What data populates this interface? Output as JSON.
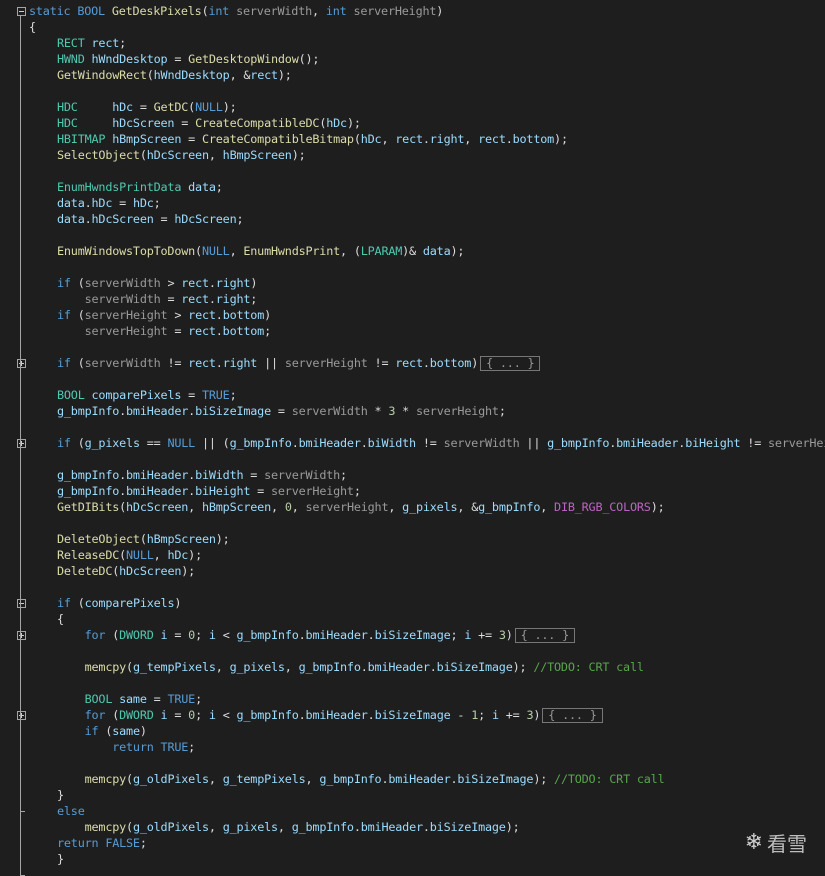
{
  "editor": {
    "lines": [
      [
        [
          "k",
          "static "
        ],
        [
          "k",
          "BOOL "
        ],
        [
          "f",
          "GetDeskPixels"
        ],
        [
          "s",
          "("
        ],
        [
          "k",
          "int "
        ],
        [
          "p",
          "serverWidth"
        ],
        [
          "s",
          ", "
        ],
        [
          "k",
          "int "
        ],
        [
          "p",
          "serverHeight"
        ],
        [
          "s",
          ")"
        ]
      ],
      [
        [
          "s",
          "{"
        ]
      ],
      [
        [
          "t",
          "RECT "
        ],
        [
          "v",
          "rect"
        ],
        [
          "s",
          ";"
        ]
      ],
      [
        [
          "t",
          "HWND "
        ],
        [
          "v",
          "hWndDesktop"
        ],
        [
          "s",
          " = "
        ],
        [
          "f",
          "GetDesktopWindow"
        ],
        [
          "s",
          "();"
        ]
      ],
      [
        [
          "f",
          "GetWindowRect"
        ],
        [
          "s",
          "("
        ],
        [
          "v",
          "hWndDesktop"
        ],
        [
          "s",
          ", &"
        ],
        [
          "v",
          "rect"
        ],
        [
          "s",
          ");"
        ]
      ],
      [],
      [
        [
          "t",
          "HDC     "
        ],
        [
          "v",
          "hDc"
        ],
        [
          "s",
          " = "
        ],
        [
          "f",
          "GetDC"
        ],
        [
          "s",
          "("
        ],
        [
          "k",
          "NULL"
        ],
        [
          "s",
          ");"
        ]
      ],
      [
        [
          "t",
          "HDC     "
        ],
        [
          "v",
          "hDcScreen"
        ],
        [
          "s",
          " = "
        ],
        [
          "f",
          "CreateCompatibleDC"
        ],
        [
          "s",
          "("
        ],
        [
          "v",
          "hDc"
        ],
        [
          "s",
          ");"
        ]
      ],
      [
        [
          "t",
          "HBITMAP "
        ],
        [
          "v",
          "hBmpScreen"
        ],
        [
          "s",
          " = "
        ],
        [
          "f",
          "CreateCompatibleBitmap"
        ],
        [
          "s",
          "("
        ],
        [
          "v",
          "hDc"
        ],
        [
          "s",
          ", "
        ],
        [
          "v",
          "rect"
        ],
        [
          "s",
          "."
        ],
        [
          "v",
          "right"
        ],
        [
          "s",
          ", "
        ],
        [
          "v",
          "rect"
        ],
        [
          "s",
          "."
        ],
        [
          "v",
          "bottom"
        ],
        [
          "s",
          ");"
        ]
      ],
      [
        [
          "f",
          "SelectObject"
        ],
        [
          "s",
          "("
        ],
        [
          "v",
          "hDcScreen"
        ],
        [
          "s",
          ", "
        ],
        [
          "v",
          "hBmpScreen"
        ],
        [
          "s",
          ");"
        ]
      ],
      [],
      [
        [
          "t",
          "EnumHwndsPrintData "
        ],
        [
          "v",
          "data"
        ],
        [
          "s",
          ";"
        ]
      ],
      [
        [
          "v",
          "data"
        ],
        [
          "s",
          "."
        ],
        [
          "v",
          "hDc"
        ],
        [
          "s",
          " = "
        ],
        [
          "v",
          "hDc"
        ],
        [
          "s",
          ";"
        ]
      ],
      [
        [
          "v",
          "data"
        ],
        [
          "s",
          "."
        ],
        [
          "v",
          "hDcScreen"
        ],
        [
          "s",
          " = "
        ],
        [
          "v",
          "hDcScreen"
        ],
        [
          "s",
          ";"
        ]
      ],
      [],
      [
        [
          "f",
          "EnumWindowsTopToDown"
        ],
        [
          "s",
          "("
        ],
        [
          "k",
          "NULL"
        ],
        [
          "s",
          ", "
        ],
        [
          "f",
          "EnumHwndsPrint"
        ],
        [
          "s",
          ", ("
        ],
        [
          "t",
          "LPARAM"
        ],
        [
          "s",
          ")& "
        ],
        [
          "v",
          "data"
        ],
        [
          "s",
          ");"
        ]
      ],
      [],
      [
        [
          "k",
          "if "
        ],
        [
          "s",
          "("
        ],
        [
          "p",
          "serverWidth"
        ],
        [
          "s",
          " > "
        ],
        [
          "v",
          "rect"
        ],
        [
          "s",
          "."
        ],
        [
          "v",
          "right"
        ],
        [
          "s",
          ")"
        ]
      ],
      [
        [
          "s",
          "    "
        ],
        [
          "p",
          "serverWidth"
        ],
        [
          "s",
          " = "
        ],
        [
          "v",
          "rect"
        ],
        [
          "s",
          "."
        ],
        [
          "v",
          "right"
        ],
        [
          "s",
          ";"
        ]
      ],
      [
        [
          "k",
          "if "
        ],
        [
          "s",
          "("
        ],
        [
          "p",
          "serverHeight"
        ],
        [
          "s",
          " > "
        ],
        [
          "v",
          "rect"
        ],
        [
          "s",
          "."
        ],
        [
          "v",
          "bottom"
        ],
        [
          "s",
          ")"
        ]
      ],
      [
        [
          "s",
          "    "
        ],
        [
          "p",
          "serverHeight"
        ],
        [
          "s",
          " = "
        ],
        [
          "v",
          "rect"
        ],
        [
          "s",
          "."
        ],
        [
          "v",
          "bottom"
        ],
        [
          "s",
          ";"
        ]
      ],
      [],
      [
        [
          "k",
          "if "
        ],
        [
          "s",
          "("
        ],
        [
          "p",
          "serverWidth"
        ],
        [
          "s",
          " != "
        ],
        [
          "v",
          "rect"
        ],
        [
          "s",
          "."
        ],
        [
          "v",
          "right"
        ],
        [
          "s",
          " || "
        ],
        [
          "p",
          "serverHeight"
        ],
        [
          "s",
          " != "
        ],
        [
          "v",
          "rect"
        ],
        [
          "s",
          "."
        ],
        [
          "v",
          "bottom"
        ],
        [
          "s",
          ")"
        ],
        [
          "box",
          "{ ... }"
        ]
      ],
      [],
      [
        [
          "t",
          "BOOL "
        ],
        [
          "v",
          "comparePixels"
        ],
        [
          "s",
          " = "
        ],
        [
          "k",
          "TRUE"
        ],
        [
          "s",
          ";"
        ]
      ],
      [
        [
          "v",
          "g_bmpInfo"
        ],
        [
          "s",
          "."
        ],
        [
          "v",
          "bmiHeader"
        ],
        [
          "s",
          "."
        ],
        [
          "v",
          "biSizeImage"
        ],
        [
          "s",
          " = "
        ],
        [
          "p",
          "serverWidth"
        ],
        [
          "s",
          " * "
        ],
        [
          "n",
          "3"
        ],
        [
          "s",
          " * "
        ],
        [
          "p",
          "serverHeight"
        ],
        [
          "s",
          ";"
        ]
      ],
      [],
      [
        [
          "k",
          "if "
        ],
        [
          "s",
          "("
        ],
        [
          "v",
          "g_pixels"
        ],
        [
          "s",
          " == "
        ],
        [
          "k",
          "NULL"
        ],
        [
          "s",
          " || ("
        ],
        [
          "v",
          "g_bmpInfo"
        ],
        [
          "s",
          "."
        ],
        [
          "v",
          "bmiHeader"
        ],
        [
          "s",
          "."
        ],
        [
          "v",
          "biWidth"
        ],
        [
          "s",
          " != "
        ],
        [
          "p",
          "serverWidth"
        ],
        [
          "s",
          " || "
        ],
        [
          "v",
          "g_bmpInfo"
        ],
        [
          "s",
          "."
        ],
        [
          "v",
          "bmiHeader"
        ],
        [
          "s",
          "."
        ],
        [
          "v",
          "biHeight"
        ],
        [
          "s",
          " != "
        ],
        [
          "p",
          "serverHeight"
        ]
      ],
      [],
      [
        [
          "v",
          "g_bmpInfo"
        ],
        [
          "s",
          "."
        ],
        [
          "v",
          "bmiHeader"
        ],
        [
          "s",
          "."
        ],
        [
          "v",
          "biWidth"
        ],
        [
          "s",
          " = "
        ],
        [
          "p",
          "serverWidth"
        ],
        [
          "s",
          ";"
        ]
      ],
      [
        [
          "v",
          "g_bmpInfo"
        ],
        [
          "s",
          "."
        ],
        [
          "v",
          "bmiHeader"
        ],
        [
          "s",
          "."
        ],
        [
          "v",
          "biHeight"
        ],
        [
          "s",
          " = "
        ],
        [
          "p",
          "serverHeight"
        ],
        [
          "s",
          ";"
        ]
      ],
      [
        [
          "f",
          "GetDIBits"
        ],
        [
          "s",
          "("
        ],
        [
          "v",
          "hDcScreen"
        ],
        [
          "s",
          ", "
        ],
        [
          "v",
          "hBmpScreen"
        ],
        [
          "s",
          ", "
        ],
        [
          "n",
          "0"
        ],
        [
          "s",
          ", "
        ],
        [
          "p",
          "serverHeight"
        ],
        [
          "s",
          ", "
        ],
        [
          "v",
          "g_pixels"
        ],
        [
          "s",
          ", &"
        ],
        [
          "v",
          "g_bmpInfo"
        ],
        [
          "s",
          ", "
        ],
        [
          "m",
          "DIB_RGB_COLORS"
        ],
        [
          "s",
          ");"
        ]
      ],
      [],
      [
        [
          "f",
          "DeleteObject"
        ],
        [
          "s",
          "("
        ],
        [
          "v",
          "hBmpScreen"
        ],
        [
          "s",
          ");"
        ]
      ],
      [
        [
          "f",
          "ReleaseDC"
        ],
        [
          "s",
          "("
        ],
        [
          "k",
          "NULL"
        ],
        [
          "s",
          ", "
        ],
        [
          "v",
          "hDc"
        ],
        [
          "s",
          ");"
        ]
      ],
      [
        [
          "f",
          "DeleteDC"
        ],
        [
          "s",
          "("
        ],
        [
          "v",
          "hDcScreen"
        ],
        [
          "s",
          ");"
        ]
      ],
      [],
      [
        [
          "k",
          "if "
        ],
        [
          "s",
          "("
        ],
        [
          "v",
          "comparePixels"
        ],
        [
          "s",
          ")"
        ]
      ],
      [
        [
          "s",
          "{"
        ]
      ],
      [
        [
          "s",
          "    "
        ],
        [
          "k",
          "for "
        ],
        [
          "s",
          "("
        ],
        [
          "t",
          "DWORD "
        ],
        [
          "v",
          "i"
        ],
        [
          "s",
          " = "
        ],
        [
          "n",
          "0"
        ],
        [
          "s",
          "; "
        ],
        [
          "v",
          "i"
        ],
        [
          "s",
          " < "
        ],
        [
          "v",
          "g_bmpInfo"
        ],
        [
          "s",
          "."
        ],
        [
          "v",
          "bmiHeader"
        ],
        [
          "s",
          "."
        ],
        [
          "v",
          "biSizeImage"
        ],
        [
          "s",
          "; "
        ],
        [
          "v",
          "i"
        ],
        [
          "s",
          " += "
        ],
        [
          "n",
          "3"
        ],
        [
          "s",
          ")"
        ],
        [
          "box",
          "{ ... }"
        ]
      ],
      [],
      [
        [
          "s",
          "    "
        ],
        [
          "f",
          "memcpy"
        ],
        [
          "s",
          "("
        ],
        [
          "v",
          "g_tempPixels"
        ],
        [
          "s",
          ", "
        ],
        [
          "v",
          "g_pixels"
        ],
        [
          "s",
          ", "
        ],
        [
          "v",
          "g_bmpInfo"
        ],
        [
          "s",
          "."
        ],
        [
          "v",
          "bmiHeader"
        ],
        [
          "s",
          "."
        ],
        [
          "v",
          "biSizeImage"
        ],
        [
          "s",
          "); "
        ],
        [
          "c",
          "//TODO: CRT call"
        ]
      ],
      [],
      [
        [
          "s",
          "    "
        ],
        [
          "t",
          "BOOL "
        ],
        [
          "v",
          "same"
        ],
        [
          "s",
          " = "
        ],
        [
          "k",
          "TRUE"
        ],
        [
          "s",
          ";"
        ]
      ],
      [
        [
          "s",
          "    "
        ],
        [
          "k",
          "for "
        ],
        [
          "s",
          "("
        ],
        [
          "t",
          "DWORD "
        ],
        [
          "v",
          "i"
        ],
        [
          "s",
          " = "
        ],
        [
          "n",
          "0"
        ],
        [
          "s",
          "; "
        ],
        [
          "v",
          "i"
        ],
        [
          "s",
          " < "
        ],
        [
          "v",
          "g_bmpInfo"
        ],
        [
          "s",
          "."
        ],
        [
          "v",
          "bmiHeader"
        ],
        [
          "s",
          "."
        ],
        [
          "v",
          "biSizeImage"
        ],
        [
          "s",
          " - "
        ],
        [
          "n",
          "1"
        ],
        [
          "s",
          "; "
        ],
        [
          "v",
          "i"
        ],
        [
          "s",
          " += "
        ],
        [
          "n",
          "3"
        ],
        [
          "s",
          ")"
        ],
        [
          "box",
          "{ ... }"
        ]
      ],
      [
        [
          "s",
          "    "
        ],
        [
          "k",
          "if "
        ],
        [
          "s",
          "("
        ],
        [
          "v",
          "same"
        ],
        [
          "s",
          ")"
        ]
      ],
      [
        [
          "s",
          "        "
        ],
        [
          "k",
          "return "
        ],
        [
          "k",
          "TRUE"
        ],
        [
          "s",
          ";"
        ]
      ],
      [],
      [
        [
          "s",
          "    "
        ],
        [
          "f",
          "memcpy"
        ],
        [
          "s",
          "("
        ],
        [
          "v",
          "g_oldPixels"
        ],
        [
          "s",
          ", "
        ],
        [
          "v",
          "g_tempPixels"
        ],
        [
          "s",
          ", "
        ],
        [
          "v",
          "g_bmpInfo"
        ],
        [
          "s",
          "."
        ],
        [
          "v",
          "bmiHeader"
        ],
        [
          "s",
          "."
        ],
        [
          "v",
          "biSizeImage"
        ],
        [
          "s",
          "); "
        ],
        [
          "c",
          "//TODO: CRT call"
        ]
      ],
      [
        [
          "s",
          "}"
        ]
      ],
      [
        [
          "k",
          "else"
        ]
      ],
      [
        [
          "s",
          "    "
        ],
        [
          "f",
          "memcpy"
        ],
        [
          "s",
          "("
        ],
        [
          "v",
          "g_oldPixels"
        ],
        [
          "s",
          ", "
        ],
        [
          "v",
          "g_pixels"
        ],
        [
          "s",
          ", "
        ],
        [
          "v",
          "g_bmpInfo"
        ],
        [
          "s",
          "."
        ],
        [
          "v",
          "bmiHeader"
        ],
        [
          "s",
          "."
        ],
        [
          "v",
          "biSizeImage"
        ],
        [
          "s",
          ");"
        ]
      ],
      [
        [
          "k",
          "return "
        ],
        [
          "k",
          "FALSE"
        ],
        [
          "s",
          ";"
        ]
      ],
      [
        [
          "s",
          "}"
        ]
      ]
    ],
    "indents": [
      0,
      0,
      1,
      1,
      1,
      1,
      1,
      1,
      1,
      1,
      1,
      1,
      1,
      1,
      1,
      1,
      1,
      1,
      1,
      1,
      1,
      1,
      1,
      1,
      1,
      1,
      1,
      1,
      1,
      1,
      1,
      1,
      1,
      1,
      1,
      1,
      1,
      1,
      1,
      1,
      1,
      1,
      1,
      1,
      1,
      1,
      1,
      1,
      1,
      1,
      1,
      1,
      1,
      1,
      0
    ],
    "folds": {
      "0": "minus",
      "22": "plus",
      "27": "plus",
      "37": "minus",
      "39": "plus",
      "44": "plus"
    }
  },
  "watermark": {
    "text": "看雪",
    "icon": "snowflake-icon"
  }
}
